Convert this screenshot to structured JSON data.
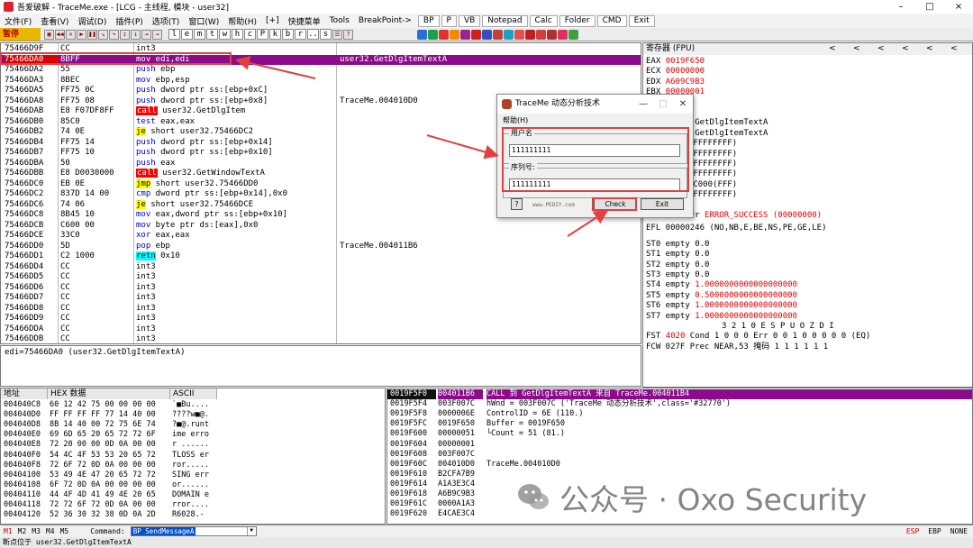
{
  "window": {
    "title": "吾爱破解 - TraceMe.exe - [LCG - 主线程, 模块 - user32]",
    "controls": [
      "–",
      "□",
      "×"
    ]
  },
  "menu": {
    "items": [
      "文件(F)",
      "查看(V)",
      "调试(D)",
      "插件(P)",
      "选项(T)",
      "窗口(W)",
      "帮助(H)",
      "[+]",
      "快捷菜单",
      "Tools",
      "BreakPoint->"
    ],
    "buttons": [
      "BP",
      "P",
      "VB",
      "Notepad",
      "Calc",
      "Folder",
      "CMD",
      "Exit"
    ]
  },
  "toolbar": {
    "status": "暂停",
    "letters": [
      "l",
      "e",
      "m",
      "t",
      "w",
      "h",
      "c",
      "P",
      "k",
      "b",
      "r",
      "...",
      "s"
    ]
  },
  "disasm": {
    "rows": [
      {
        "addr": "75466D9F",
        "hex": "CC",
        "ins": "int3",
        "kind": "int",
        "cmt": ""
      },
      {
        "addr": "75466DA0",
        "hex": "8BFF",
        "ins": "mov edi,edi",
        "kind": "mov",
        "cmt": "user32.GetDlgItemTextA",
        "sel": true
      },
      {
        "addr": "75466DA2",
        "hex": "55",
        "ins": "push ebp",
        "kind": "push",
        "cmt": ""
      },
      {
        "addr": "75466DA3",
        "hex": "8BEC",
        "ins": "mov ebp,esp",
        "kind": "mov",
        "cmt": ""
      },
      {
        "addr": "75466DA5",
        "hex": "FF75 0C",
        "ins": "push dword ptr ss:[ebp+0xC]",
        "kind": "push",
        "cmt": ""
      },
      {
        "addr": "75466DA8",
        "hex": "FF75 08",
        "ins": "push dword ptr ss:[ebp+0x8]",
        "kind": "push",
        "cmt": "TraceMe.004010D0"
      },
      {
        "addr": "75466DAB",
        "hex": "E8 F07DF8FF",
        "ins": "call user32.GetDlgItem",
        "kind": "call",
        "cmt": ""
      },
      {
        "addr": "75466DB0",
        "hex": "85C0",
        "ins": "test eax,eax",
        "kind": "mov",
        "cmt": ""
      },
      {
        "addr": "75466DB2",
        "hex": "74 0E",
        "ins": "je short user32.75466DC2",
        "kind": "jmp",
        "cmt": ""
      },
      {
        "addr": "75466DB4",
        "hex": "FF75 14",
        "ins": "push dword ptr ss:[ebp+0x14]",
        "kind": "push",
        "cmt": ""
      },
      {
        "addr": "75466DB7",
        "hex": "FF75 10",
        "ins": "push dword ptr ss:[ebp+0x10]",
        "kind": "push",
        "cmt": ""
      },
      {
        "addr": "75466DBA",
        "hex": "50",
        "ins": "push eax",
        "kind": "push",
        "cmt": ""
      },
      {
        "addr": "75466DBB",
        "hex": "E8 D0030000",
        "ins": "call user32.GetWindowTextA",
        "kind": "call",
        "cmt": ""
      },
      {
        "addr": "75466DC0",
        "hex": "EB 0E",
        "ins": "jmp short user32.75466DD0",
        "kind": "jmp",
        "cmt": ""
      },
      {
        "addr": "75466DC2",
        "hex": "837D 14 00",
        "ins": "cmp dword ptr ss:[ebp+0x14],0x0",
        "kind": "mov",
        "cmt": ""
      },
      {
        "addr": "75466DC6",
        "hex": "74 06",
        "ins": "je short user32.75466DCE",
        "kind": "jmp",
        "cmt": ""
      },
      {
        "addr": "75466DC8",
        "hex": "8B45 10",
        "ins": "mov eax,dword ptr ss:[ebp+0x10]",
        "kind": "mov",
        "cmt": ""
      },
      {
        "addr": "75466DCB",
        "hex": "C600 00",
        "ins": "mov byte ptr ds:[eax],0x0",
        "kind": "mov",
        "cmt": ""
      },
      {
        "addr": "75466DCE",
        "hex": "33C0",
        "ins": "xor eax,eax",
        "kind": "mov",
        "cmt": ""
      },
      {
        "addr": "75466DD0",
        "hex": "5D",
        "ins": "pop ebp",
        "kind": "push",
        "cmt": "TraceMe.004011B6"
      },
      {
        "addr": "75466DD1",
        "hex": "C2 1000",
        "ins": "retn 0x10",
        "kind": "ret",
        "cmt": ""
      },
      {
        "addr": "75466DD4",
        "hex": "CC",
        "ins": "int3",
        "kind": "int",
        "cmt": ""
      },
      {
        "addr": "75466DD5",
        "hex": "CC",
        "ins": "int3",
        "kind": "int",
        "cmt": ""
      },
      {
        "addr": "75466DD6",
        "hex": "CC",
        "ins": "int3",
        "kind": "int",
        "cmt": ""
      },
      {
        "addr": "75466DD7",
        "hex": "CC",
        "ins": "int3",
        "kind": "int",
        "cmt": ""
      },
      {
        "addr": "75466DD8",
        "hex": "CC",
        "ins": "int3",
        "kind": "int",
        "cmt": ""
      },
      {
        "addr": "75466DD9",
        "hex": "CC",
        "ins": "int3",
        "kind": "int",
        "cmt": ""
      },
      {
        "addr": "75466DDA",
        "hex": "CC",
        "ins": "int3",
        "kind": "int",
        "cmt": ""
      },
      {
        "addr": "75466DDB",
        "hex": "CC",
        "ins": "int3",
        "kind": "int",
        "cmt": ""
      },
      {
        "addr": "75466DDC",
        "hex": "CC",
        "ins": "int3",
        "kind": "int",
        "cmt": ""
      }
    ],
    "info": "edi=75466DA0 (user32.GetDlgItemTextA)"
  },
  "registers": {
    "title": "寄存器 (FPU)",
    "arrows": [
      "<",
      "<",
      "<",
      "<",
      "<",
      "<"
    ],
    "gp": [
      {
        "name": "EAX",
        "val": "0019F650",
        "note": ""
      },
      {
        "name": "ECX",
        "val": "00000000",
        "note": ""
      },
      {
        "name": "EDX",
        "val": "A609C9B3",
        "note": ""
      },
      {
        "name": "EBX",
        "val": "00000001",
        "note": ""
      }
    ],
    "partials": [
      {
        "text": "2C",
        "note": ""
      },
      {
        "text": "7C",
        "note": ""
      },
      {
        "text": "A0",
        "note": "user32.GetDlgItemTextA"
      },
      {
        "text": "A0",
        "note": "user32.GetDlgItemTextA"
      }
    ],
    "segs": [
      "2B  32位  0(FFFFFFFF)",
      "23  32位  0(FFFFFFFF)",
      "2B  32位  0(FFFFFFFF)",
      "2B  32位  0(FFFFFFFF)",
      "53  32位  24C000(FFF)",
      "2B  32位  0(FFFFFFFF)"
    ],
    "flags_d": "D 0",
    "lasterr_prefix": "O 0   LastErr",
    "lasterr_val": "ERROR_SUCCESS (00000000)",
    "efl": "EFL 00000246 (NO,NB,E,BE,NS,PE,GE,LE)",
    "st": [
      {
        "name": "ST0",
        "state": "empty",
        "val": "0.0",
        "red": false
      },
      {
        "name": "ST1",
        "state": "empty",
        "val": "0.0",
        "red": false
      },
      {
        "name": "ST2",
        "state": "empty",
        "val": "0.0",
        "red": false
      },
      {
        "name": "ST3",
        "state": "empty",
        "val": "0.0",
        "red": false
      },
      {
        "name": "ST4",
        "state": "empty",
        "val": "1.0000000000000000000",
        "red": true
      },
      {
        "name": "ST5",
        "state": "empty",
        "val": "0.5000000000000000000",
        "red": true
      },
      {
        "name": "ST6",
        "state": "empty",
        "val": "1.0000000000000000000",
        "red": true
      },
      {
        "name": "ST7",
        "state": "empty",
        "val": "1.0000000000000000000",
        "red": true
      }
    ],
    "fpu_header": "3 2 1 0      E S P U O Z D I",
    "fst_label": "FST",
    "fst_val": "4020",
    "fst_rest": "Cond 1 0 0 0  Err 0 0 1 0 0 0 0 0  (EQ)",
    "fcw": "FCW 027F  Prec NEAR,53  掩码    1 1 1 1 1 1"
  },
  "dump": {
    "headers": [
      "地址",
      "HEX 数据",
      "ASCII"
    ],
    "rows": [
      {
        "addr": "004040C8",
        "hex": "60 12 42 75 00 00 00 00",
        "ascii": "`■Bu...."
      },
      {
        "addr": "004040D0",
        "hex": "FF FF FF FF 77 14 40 00",
        "ascii": "????w■@."
      },
      {
        "addr": "004040D8",
        "hex": "8B 14 40 00 72 75 6E 74",
        "ascii": "?■@.runt"
      },
      {
        "addr": "004040E0",
        "hex": "69 6D 65 20 65 72 72 6F",
        "ascii": "ime erro"
      },
      {
        "addr": "004040E8",
        "hex": "72 20 00 00 0D 0A 00 00",
        "ascii": "r ......"
      },
      {
        "addr": "004040F0",
        "hex": "54 4C 4F 53 53 20 65 72",
        "ascii": "TLOSS er"
      },
      {
        "addr": "004040F8",
        "hex": "72 6F 72 0D 0A 00 00 00",
        "ascii": "ror....."
      },
      {
        "addr": "00404100",
        "hex": "53 49 4E 47 20 65 72 72",
        "ascii": "SING err"
      },
      {
        "addr": "00404108",
        "hex": "6F 72 0D 0A 00 00 00 00",
        "ascii": "or......"
      },
      {
        "addr": "00404110",
        "hex": "44 4F 4D 41 49 4E 20 65",
        "ascii": "DOMAIN e"
      },
      {
        "addr": "00404118",
        "hex": "72 72 6F 72 0D 0A 00 00",
        "ascii": "rror...."
      },
      {
        "addr": "00404120",
        "hex": "52 36 30 32 38 0D 0A 2D",
        "ascii": "R6028.-"
      }
    ]
  },
  "stack": {
    "rows": [
      {
        "addr": "0019F5F0",
        "val": "004011B6",
        "cmt": "CALL 到 GetDlgItemTextA 来自 TraceMe.004011B4",
        "sel": true
      },
      {
        "addr": "0019F5F4",
        "val": "003F007C",
        "cmt": "hWnd = 003F007C ('TraceMe 动态分析技术',class='#32770')"
      },
      {
        "addr": "0019F5F8",
        "val": "0000006E",
        "cmt": "ControlID = 6E (110.)"
      },
      {
        "addr": "0019F5FC",
        "val": "0019F650",
        "cmt": "Buffer = 0019F650"
      },
      {
        "addr": "0019F600",
        "val": "00000051",
        "cmt": "└Count = 51 (81.)"
      },
      {
        "addr": "0019F604",
        "val": "00000001",
        "cmt": ""
      },
      {
        "addr": "0019F608",
        "val": "003F007C",
        "cmt": ""
      },
      {
        "addr": "0019F60C",
        "val": "004010D0",
        "cmt": "TraceMe.004010D0"
      },
      {
        "addr": "0019F610",
        "val": "B2CFA7B9",
        "cmt": ""
      },
      {
        "addr": "0019F614",
        "val": "A1A3E3C4",
        "cmt": ""
      },
      {
        "addr": "0019F618",
        "val": "A6B9C9B3",
        "cmt": ""
      },
      {
        "addr": "0019F61C",
        "val": "0000A1A3",
        "cmt": ""
      },
      {
        "addr": "0019F620",
        "val": "E4CAE3C4",
        "cmt": ""
      }
    ]
  },
  "commandbar": {
    "tabs": [
      "M1",
      "M2",
      "M3",
      "M4",
      "M5"
    ],
    "label": "Command:",
    "value": "BP SendMessageA",
    "right": [
      "ESP",
      "EBP",
      "NONE"
    ]
  },
  "statusbar": {
    "text": "断点位于 user32.GetDlgItemTextA"
  },
  "dialog": {
    "title": "TraceMe 动态分析技术",
    "menu": "帮助(H)",
    "user_label": "用户名",
    "user_value": "111111111",
    "serial_label": "序列号:",
    "serial_value": "111111111",
    "help_btn": "?",
    "site": "www.PEDIY.com",
    "check_btn": "Check",
    "exit_btn": "Exit"
  },
  "watermark": {
    "text": "公众号 · Oxo Security"
  },
  "colors": {
    "selected_row": "#8b0b8b",
    "call": "#ff0000",
    "jump": "#ffff00",
    "annotation": "#e04040"
  }
}
